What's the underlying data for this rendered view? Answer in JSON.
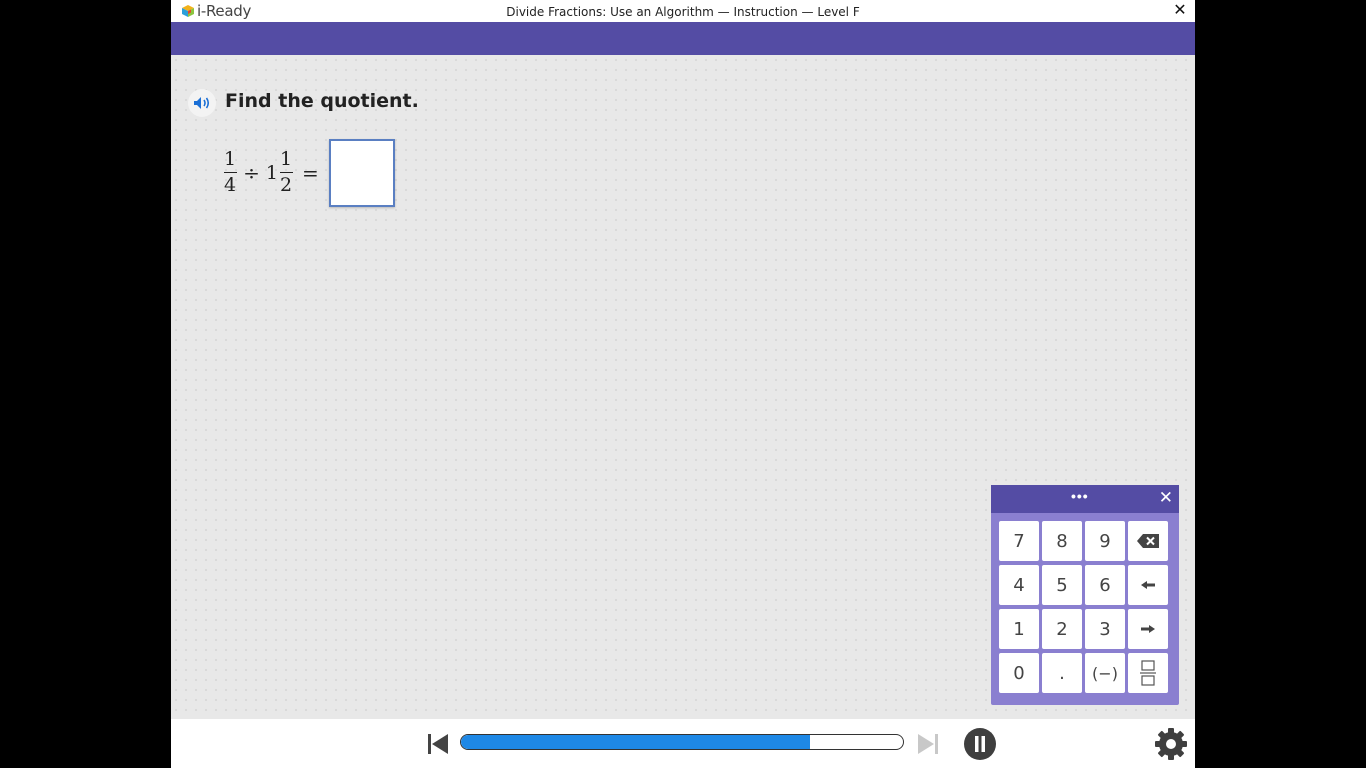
{
  "app": {
    "logo_text": "i-Ready",
    "title": "Divide Fractions: Use an Algorithm — Instruction — Level F",
    "close_label": "✕"
  },
  "question": {
    "prompt": "Find the quotient.",
    "equation": {
      "frac1_num": "1",
      "frac1_den": "4",
      "operator": "÷",
      "whole": "1",
      "frac2_num": "1",
      "frac2_den": "2",
      "equals": "=",
      "answer_value": ""
    }
  },
  "keypad": {
    "drag_handle": "•••",
    "close_label": "✕",
    "keys": [
      "7",
      "8",
      "9",
      "backspace-icon",
      "4",
      "5",
      "6",
      "arrow-left-icon",
      "1",
      "2",
      "3",
      "arrow-right-icon",
      "0",
      ".",
      "(−)",
      "fraction-icon"
    ]
  },
  "player": {
    "progress": 0.79,
    "colors": {
      "progress_fill": "#1e88e6",
      "header": "#544ca4"
    }
  }
}
